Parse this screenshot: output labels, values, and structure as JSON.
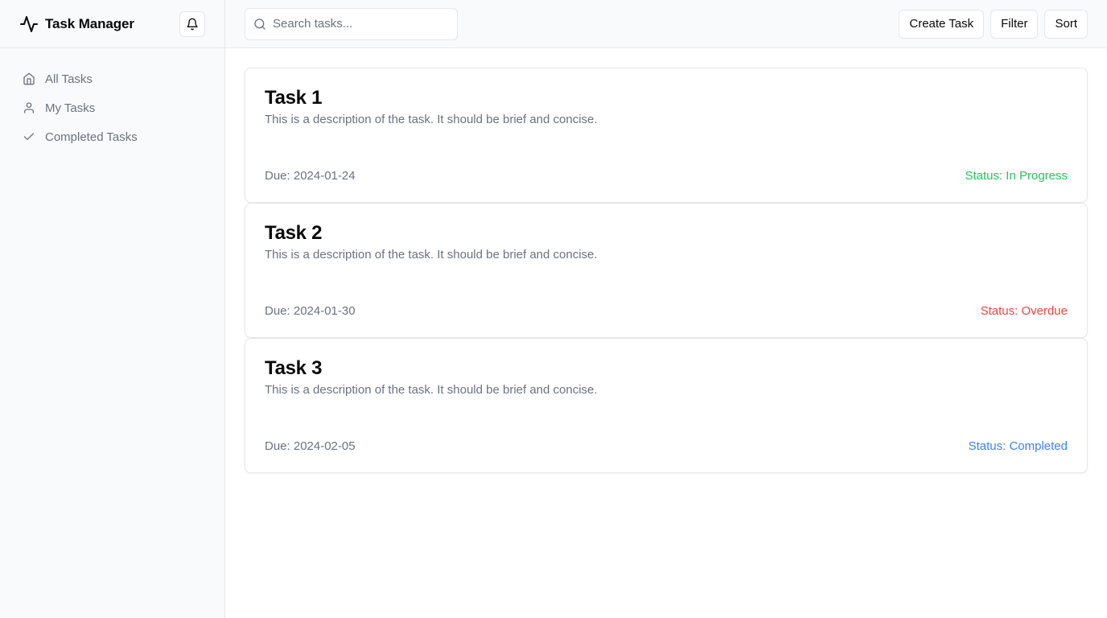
{
  "app": {
    "title": "Task Manager"
  },
  "sidebar": {
    "items": [
      {
        "label": "All Tasks",
        "icon": "home-icon"
      },
      {
        "label": "My Tasks",
        "icon": "user-icon"
      },
      {
        "label": "Completed Tasks",
        "icon": "check-icon"
      }
    ]
  },
  "search": {
    "placeholder": "Search tasks...",
    "value": ""
  },
  "toolbar": {
    "create_label": "Create Task",
    "filter_label": "Filter",
    "sort_label": "Sort"
  },
  "tasks": [
    {
      "title": "Task 1",
      "description": "This is a description of the task. It should be brief and concise.",
      "due": "Due: 2024-01-24",
      "status": "Status: In Progress",
      "status_color": "#22c55e"
    },
    {
      "title": "Task 2",
      "description": "This is a description of the task. It should be brief and concise.",
      "due": "Due: 2024-01-30",
      "status": "Status: Overdue",
      "status_color": "#ef4444"
    },
    {
      "title": "Task 3",
      "description": "This is a description of the task. It should be brief and concise.",
      "due": "Due: 2024-02-05",
      "status": "Status: Completed",
      "status_color": "#3b82f6"
    }
  ],
  "colors": {
    "sidebar_bg": "#f9fafb",
    "border": "#e5e7eb",
    "muted_text": "#6b7280"
  }
}
